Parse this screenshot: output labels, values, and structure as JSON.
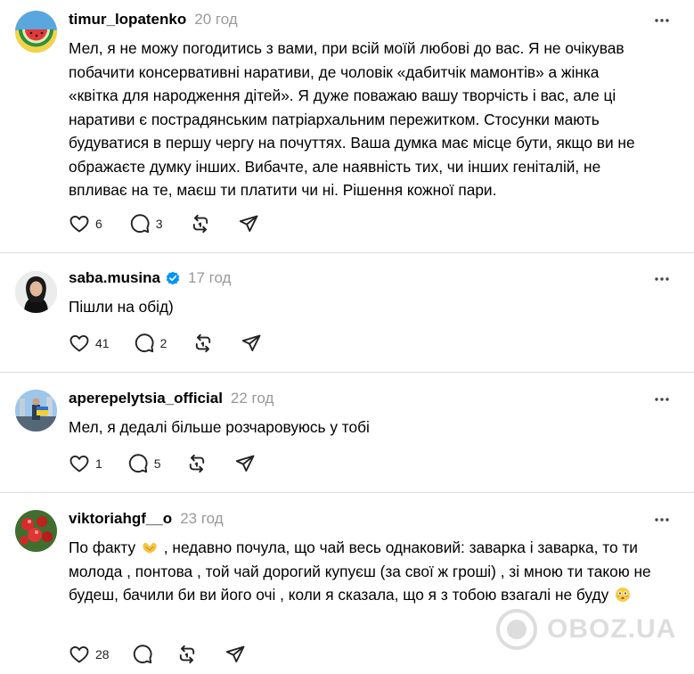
{
  "posts": [
    {
      "username": "timur_lopatenko",
      "verified": false,
      "time": "20 год",
      "text": "Мел, я не можу погодитись з вами, при всій моїй любові до вас. Я не очікував побачити консервативні наративи, де чоловік «дабитчік мамонтів» а жінка «квітка для народження дітей». Я дуже поважаю вашу творчість і вас, але ці наративи є пострадянським патріархальним пережитком. Стосунки мають будуватися в першу чергу на почуттях. Ваша думка має місце бути, якщо ви не ображаєте думку інших. Вибачте, але наявність тих, чи інших геніталій, не впливає на те, маєш ти платити чи ні. Рішення кожної пари.",
      "likes": "6",
      "replies": "3"
    },
    {
      "username": "saba.musina",
      "verified": true,
      "time": "17 год",
      "text": "Пішли на обід)",
      "likes": "41",
      "replies": "2"
    },
    {
      "username": "aperepelytsia_official",
      "verified": false,
      "time": "22 год",
      "text": "Мел, я дедалі більше розчаровуюсь у тобі",
      "likes": "1",
      "replies": "5"
    },
    {
      "username": "viktoriahgf__o",
      "verified": false,
      "time": "23 год",
      "text_part1": "По факту",
      "text_part2": ", недавно почула, що чай весь однаковий: заварка і заварка, то ти молода , понтова , той чай дорогий купуєш (за свої ж гроші) , зі мною ти такою не будеш, бачили би ви його очі , коли я сказала, що я з тобою взагалі не буду",
      "emoji1": "heart-hands-emoji",
      "emoji2": "flushed-face-emoji",
      "likes": "28",
      "replies": ""
    }
  ],
  "icons": {
    "like": "heart-icon",
    "reply": "comment-bubble-icon",
    "repost": "repost-arrows-icon",
    "share": "paper-plane-icon",
    "more": "more-dots-icon"
  },
  "colors": {
    "timestamp": "#999999",
    "verified_badge": "#0095f6",
    "divider": "#dcdcdc"
  },
  "watermark": {
    "text": "OBOZ.UA"
  }
}
